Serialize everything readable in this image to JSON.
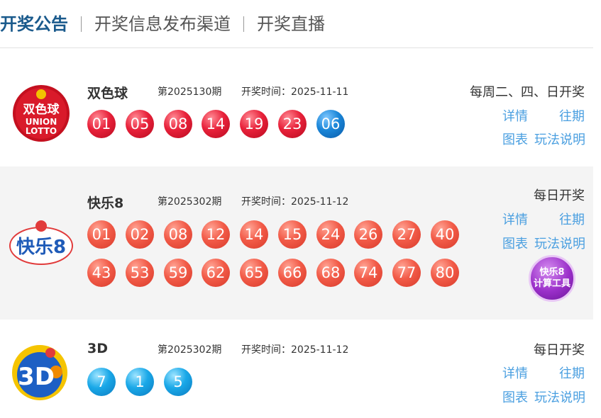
{
  "tabs": [
    {
      "label": "开奖公告"
    },
    {
      "label": "开奖信息发布渠道"
    },
    {
      "label": "开奖直播"
    }
  ],
  "lotteries": [
    {
      "name": "双色球",
      "issue": "第2025130期",
      "draw_time": "开奖时间：2025-11-11",
      "schedule": "每周二、四、日开奖",
      "logo_text": [
        "双色球",
        "UNION",
        "LOTTO"
      ],
      "red_balls": [
        "01",
        "05",
        "08",
        "14",
        "19",
        "23"
      ],
      "blue_balls": [
        "06"
      ],
      "links": {
        "detail": "详情",
        "history": "往期",
        "chart": "图表",
        "rules": "玩法说明"
      }
    },
    {
      "name": "快乐8",
      "issue": "第2025302期",
      "draw_time": "开奖时间：2025-11-12",
      "schedule": "每日开奖",
      "logo_text": [
        "快乐8"
      ],
      "balls_row1": [
        "01",
        "02",
        "08",
        "12",
        "14",
        "15",
        "24",
        "26",
        "27",
        "40"
      ],
      "balls_row2": [
        "43",
        "53",
        "59",
        "62",
        "65",
        "66",
        "68",
        "74",
        "77",
        "80"
      ],
      "calc_tool": [
        "快乐8",
        "计算工具"
      ],
      "links": {
        "detail": "详情",
        "history": "往期",
        "chart": "图表",
        "rules": "玩法说明"
      }
    },
    {
      "name": "3D",
      "issue": "第2025302期",
      "draw_time": "开奖时间：2025-11-12",
      "schedule": "每日开奖",
      "logo_text": [
        "3D"
      ],
      "balls": [
        "7",
        "1",
        "5"
      ],
      "links": {
        "detail": "详情",
        "history": "往期",
        "chart": "图表",
        "rules": "玩法说明"
      }
    }
  ],
  "colors": {
    "tab_active": "#1a5a8c",
    "link": "#4a9fe0",
    "red_ball": "#e8213a",
    "blue_ball": "#1a86d8",
    "kl8_ball": "#f25b48",
    "d3_ball": "#1aa8e8"
  }
}
